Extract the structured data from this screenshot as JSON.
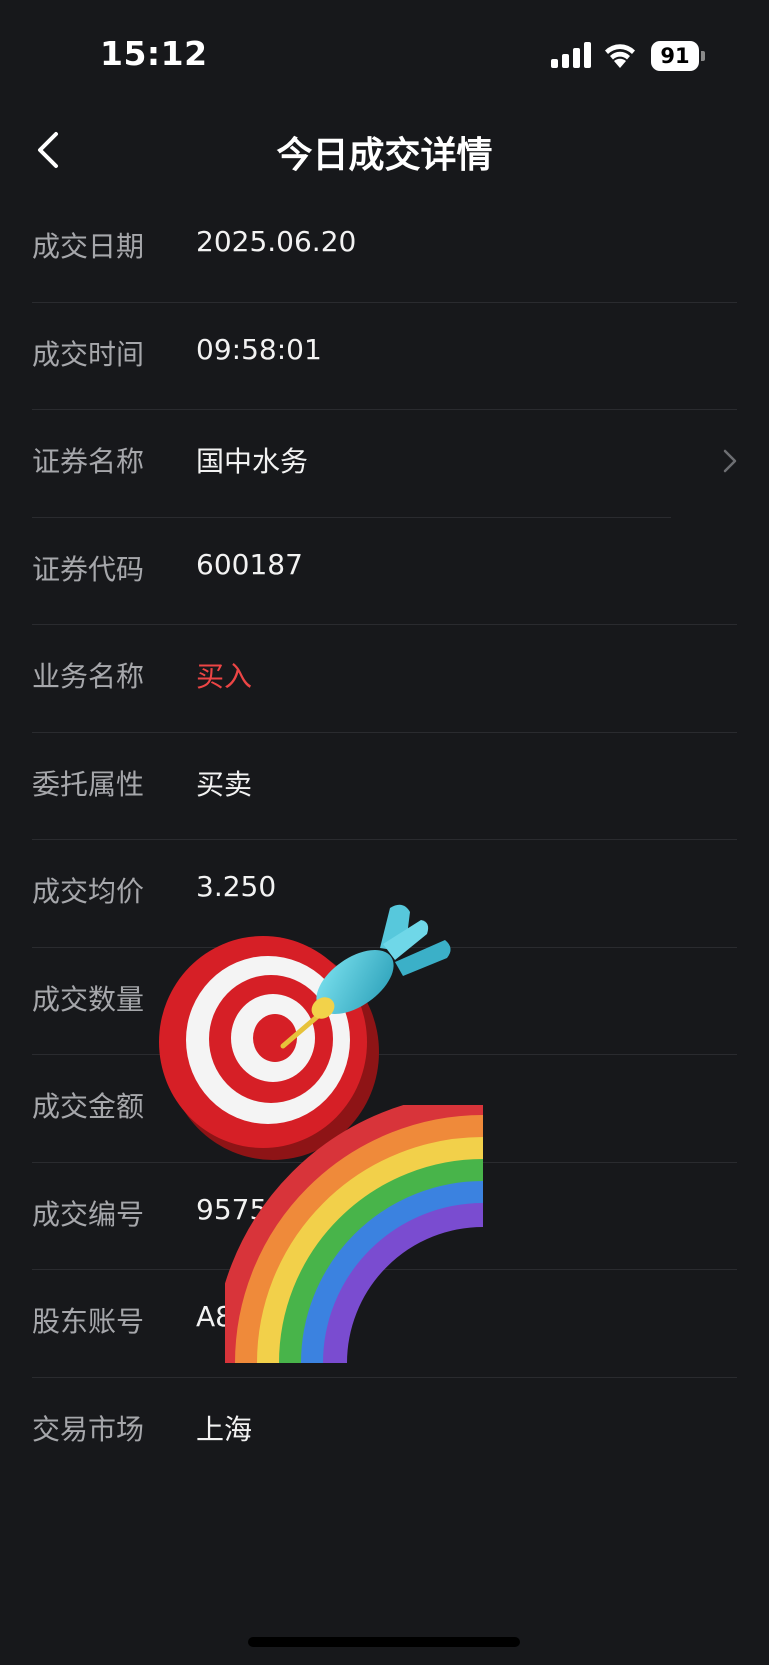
{
  "status_bar": {
    "time": "15:12",
    "battery": "91"
  },
  "nav": {
    "title": "今日成交详情"
  },
  "rows": [
    {
      "label": "成交日期",
      "value": "2025.06.20"
    },
    {
      "label": "成交时间",
      "value": "09:58:01"
    },
    {
      "label": "证券名称",
      "value": "国中水务"
    },
    {
      "label": "证券代码",
      "value": "600187"
    },
    {
      "label": "业务名称",
      "value": "买入"
    },
    {
      "label": "委托属性",
      "value": "买卖"
    },
    {
      "label": "成交均价",
      "value": "3.250"
    },
    {
      "label": "成交数量",
      "value": ""
    },
    {
      "label": "成交金额",
      "value": ""
    },
    {
      "label": "成交编号",
      "value": "95755"
    },
    {
      "label": "股东账号",
      "value": "A8"
    },
    {
      "label": "交易市场",
      "value": "上海"
    }
  ],
  "colors": {
    "background": "#17181b",
    "buy_red": "#ec4545",
    "label_gray": "#a6a7ab"
  },
  "stickers": [
    "dart-target-sticker",
    "rainbow-sticker"
  ]
}
